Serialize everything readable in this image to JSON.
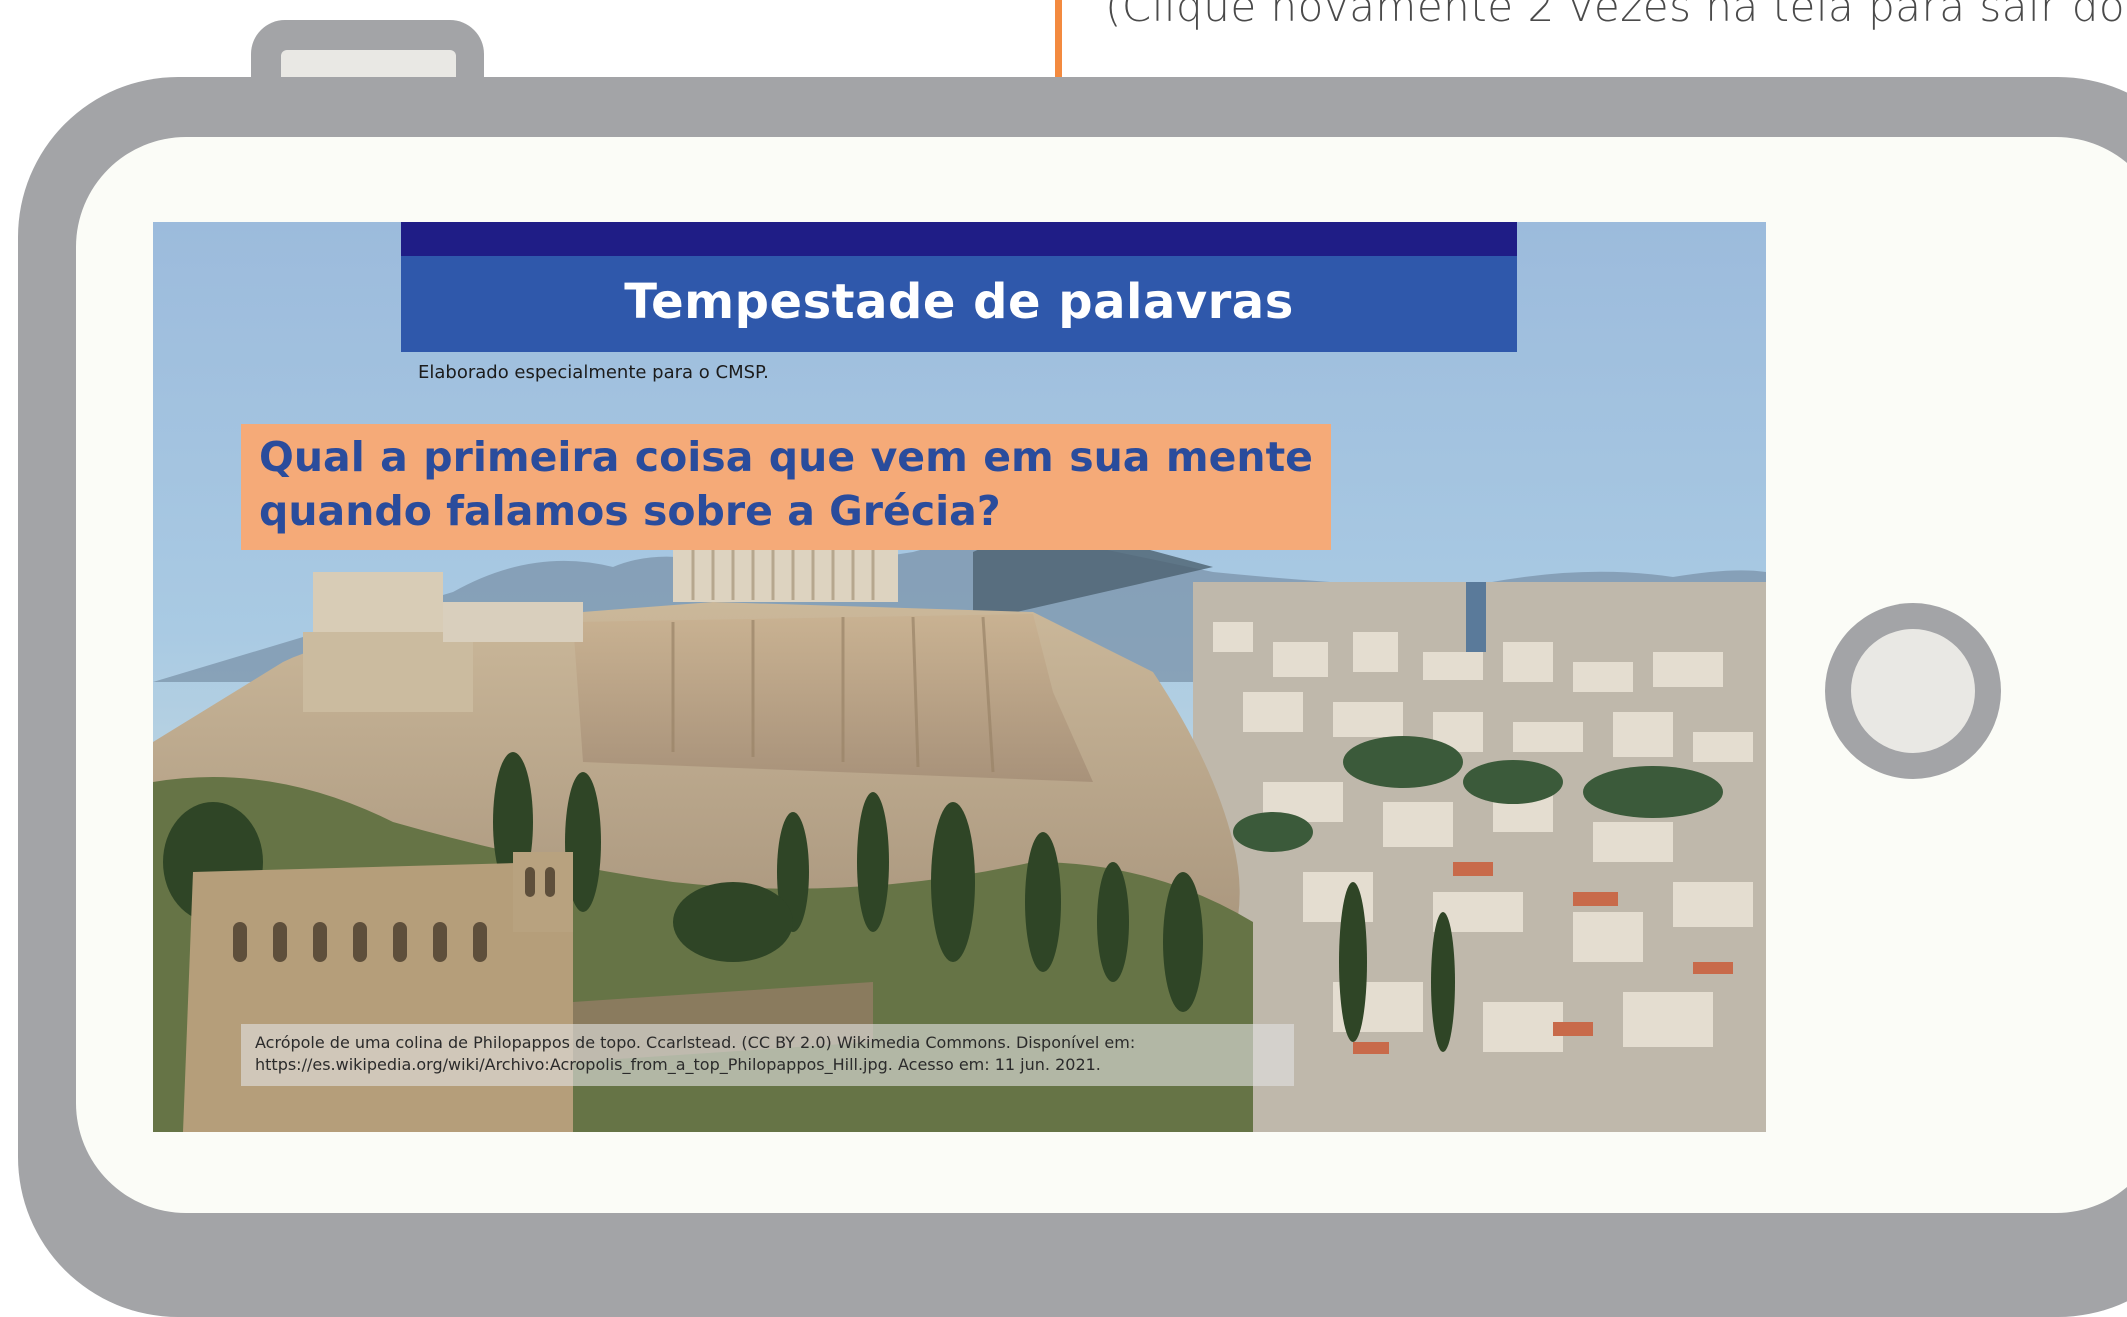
{
  "hint": {
    "text": "(Clique novamente 2 vezes na tela para sair do"
  },
  "slide": {
    "title": "Tempestade de palavras",
    "credit": "Elaborado especialmente para o CMSP.",
    "question": "Qual a primeira coisa que vem em sua mente quando falamos sobre a Grécia?",
    "caption_line1": "Acrópole de uma colina de Philopappos de topo. Ccarlstead. (CC BY 2.0) Wikimedia Commons. Disponível em:",
    "caption_line2": "https://es.wikipedia.org/wiki/Archivo:Acropolis_from_a_top_Philopappos_Hill.jpg. Acesso em: 11 jun. 2021."
  },
  "colors": {
    "frame": "#a3a4a7",
    "screen": "#fbfcf7",
    "arrow": "#f38a3f",
    "title_band": "#2f58ab",
    "title_band_top": "#1f1d86",
    "question_box": "#f5aa78",
    "question_text": "#2a4c9c"
  },
  "icons": {
    "pointer": "arrow-down-icon",
    "home": "home-button-icon",
    "camera": "camera-icon"
  }
}
